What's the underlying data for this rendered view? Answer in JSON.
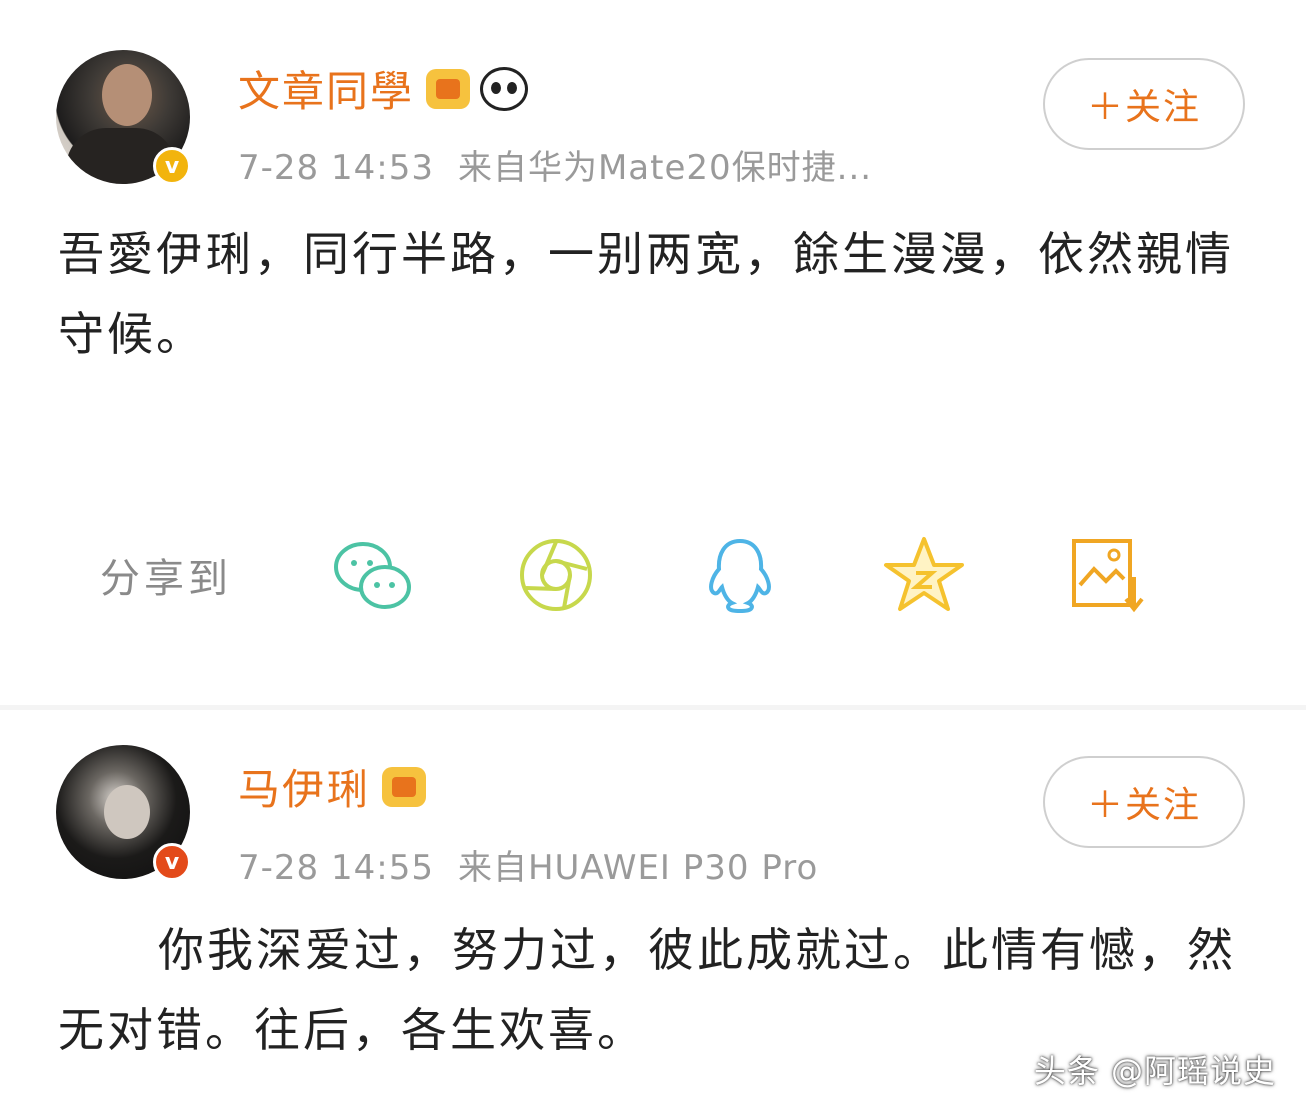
{
  "post1": {
    "username": "文章同學",
    "timestamp": "7-28 14:53",
    "source": "来自华为Mate20保时捷...",
    "follow_label": "＋关注",
    "content": "吾愛伊琍，同行半路，一别两宽，餘生漫漫，依然親情守候。",
    "verified_badge_color": "#f2b40d",
    "share": {
      "label": "分享到",
      "targets": [
        {
          "icon": "wechat-icon",
          "color": "#4cc3a4"
        },
        {
          "icon": "moments-icon",
          "color": "#c7d84c"
        },
        {
          "icon": "qq-icon",
          "color": "#4eb4e6"
        },
        {
          "icon": "qzone-star-icon",
          "color": "#f5c22e"
        },
        {
          "icon": "save-image-icon",
          "color": "#f0a623"
        }
      ]
    }
  },
  "post2": {
    "username": "马伊琍",
    "timestamp": "7-28 14:55",
    "source": "来自HUAWEI P30 Pro",
    "follow_label": "＋关注",
    "content": "你我深爱过，努力过，彼此成就过。此情有憾，然无对错。往后，各生欢喜。",
    "verified_badge_color": "#e34a1a"
  },
  "watermark": "头条 @阿瑶说史",
  "colors": {
    "username": "#e8731c",
    "meta": "#9a9a9a",
    "follow_text": "#e8731c"
  }
}
